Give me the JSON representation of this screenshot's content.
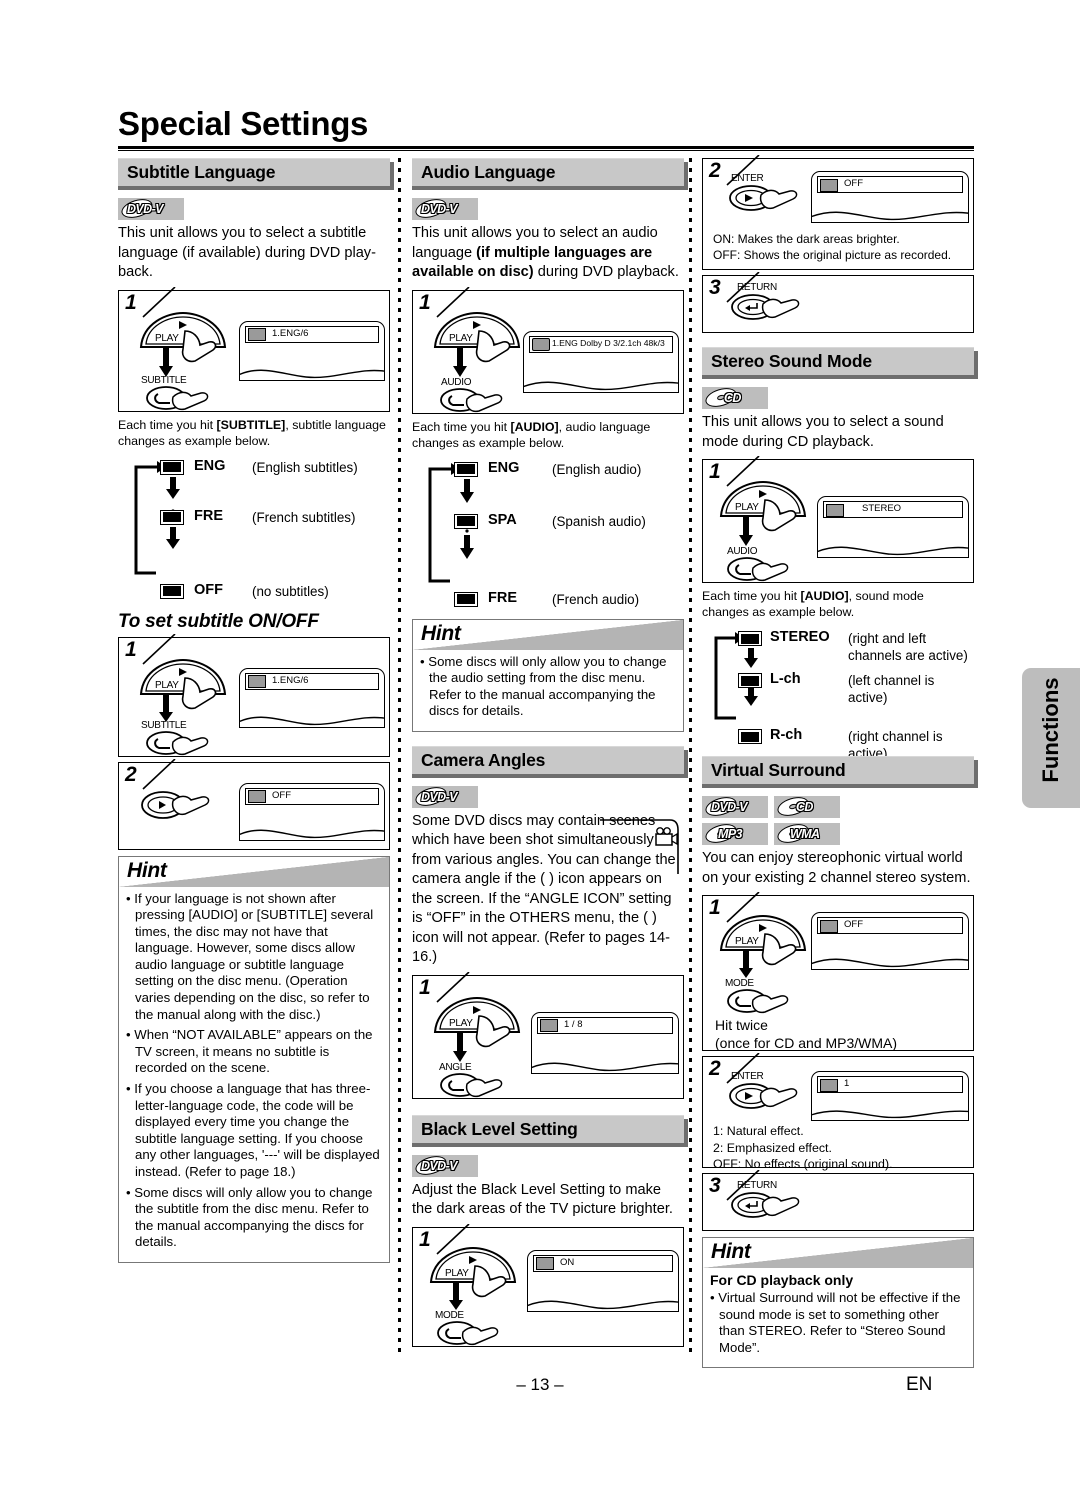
{
  "page": {
    "title": "Special Settings",
    "page_number": "– 13 –",
    "lang_mark": "EN",
    "side_tab": "Functions"
  },
  "col1": {
    "subtitle_language": {
      "heading": "Subtitle Language",
      "badges": [
        "DVD-V"
      ],
      "intro": "This unit allows you to select a subtitle language (if available) during DVD play-back.",
      "step1": {
        "num": "1",
        "btn_top": "PLAY",
        "btn_bottom": "SUBTITLE",
        "osd": "1.ENG/6"
      },
      "caption_a": "Each time you hit ",
      "caption_b": "[SUBTITLE]",
      "caption_c": ", subtitle language changes as example below.",
      "flow": [
        {
          "name": "ENG",
          "desc": "(English subtitles)"
        },
        {
          "name": "FRE",
          "desc": "(French subtitles)"
        },
        {
          "name": "OFF",
          "desc": "(no subtitles)"
        }
      ]
    },
    "to_set_onoff": {
      "subheading": "To set subtitle ON/OFF",
      "step1": {
        "num": "1",
        "btn_top": "PLAY",
        "btn_bottom": "SUBTITLE",
        "osd": "1.ENG/6"
      },
      "step2": {
        "num": "2",
        "osd": "OFF"
      }
    },
    "hint": {
      "title": "Hint",
      "items": [
        "If your language is not shown after pressing [AUDIO] or [SUBTITLE] several times, the disc may not have that language. However, some discs allow audio language or subtitle language setting on the disc menu. (Operation varies depending on the disc, so refer to the manual along with the disc.)",
        "When “NOT AVAILABLE” appears on the TV screen, it means no subtitle is recorded on the scene.",
        "If you choose a language that has three-letter-language code, the code will be displayed every time you change the subtitle language setting. If you choose any other languages, '---' will be displayed instead. (Refer to page 18.)",
        "Some discs will only allow you to change the subtitle from the disc menu. Refer to the manual accompanying the discs for details."
      ]
    }
  },
  "col2": {
    "audio_language": {
      "heading": "Audio Language",
      "badges": [
        "DVD-V"
      ],
      "intro_a": "This unit allows you to select an audio language ",
      "intro_b": "(if multiple languages are available on disc)",
      "intro_c": " during DVD playback.",
      "step1": {
        "num": "1",
        "btn_top": "PLAY",
        "btn_bottom": "AUDIO",
        "osd": "1.ENG  Dolby D  3/2.1ch  48k/3"
      },
      "caption_a": "Each time you hit ",
      "caption_b": "[AUDIO]",
      "caption_c": ", audio language changes as example below.",
      "flow": [
        {
          "name": "ENG",
          "desc": "(English audio)"
        },
        {
          "name": "SPA",
          "desc": "(Spanish audio)"
        },
        {
          "name": "FRE",
          "desc": "(French audio)"
        }
      ]
    },
    "hint": {
      "title": "Hint",
      "items": [
        "Some discs will only allow you to change the audio setting from the disc menu. Refer to the manual accompanying the discs for details."
      ]
    },
    "camera_angles": {
      "heading": "Camera Angles",
      "badges": [
        "DVD-V"
      ],
      "body": "Some DVD discs may contain scenes which have been shot simultaneously from various angles. You can change the camera angle if the (  ) icon appears on the screen. If the “ANGLE ICON” setting is “OFF” in the OTHERS menu, the (  ) icon will not appear. (Refer to pages 14-16.)",
      "step1": {
        "num": "1",
        "btn_top": "PLAY",
        "btn_bottom": "ANGLE",
        "osd": "1 / 8"
      }
    },
    "black_level": {
      "heading": "Black Level Setting",
      "badges": [
        "DVD-V"
      ],
      "body": "Adjust the Black Level Setting to make the dark areas of the TV picture brighter.",
      "step1": {
        "num": "1",
        "btn_top": "PLAY",
        "btn_bottom": "MODE",
        "osd": "ON"
      }
    }
  },
  "col3": {
    "black_level_cont": {
      "step2": {
        "num": "2",
        "btn_top": "ENTER",
        "osd": "OFF",
        "note1": "ON: Makes the dark areas brighter.",
        "note2": "OFF: Shows the original picture as recorded."
      },
      "step3": {
        "num": "3",
        "btn_top": "RETURN"
      }
    },
    "stereo_sound_mode": {
      "heading": "Stereo Sound Mode",
      "badges": [
        "CD"
      ],
      "intro": "This unit allows you to select a sound mode during CD playback.",
      "step1": {
        "num": "1",
        "btn_top": "PLAY",
        "btn_bottom": "AUDIO",
        "osd": "STEREO"
      },
      "caption_a": "Each time you hit ",
      "caption_b": "[AUDIO]",
      "caption_c": ", sound mode changes as example below.",
      "flow": [
        {
          "name": "STEREO",
          "desc": "(right and left channels are active)"
        },
        {
          "name": "L-ch",
          "desc": "(left channel is active)"
        },
        {
          "name": "R-ch",
          "desc": "(right channel is active)"
        }
      ]
    },
    "virtual_surround": {
      "heading": "Virtual Surround",
      "badges": [
        "DVD-V",
        "CD",
        "MP3",
        "WMA"
      ],
      "intro": "You can enjoy stereophonic virtual world on your existing 2 channel stereo system.",
      "step1": {
        "num": "1",
        "btn_top": "PLAY",
        "btn_bottom": "MODE",
        "osd": "OFF",
        "note1": "Hit twice",
        "note2": "(once for CD and MP3/WMA)"
      },
      "step2": {
        "num": "2",
        "btn_top": "ENTER",
        "osd": "1",
        "note1": "1: Natural effect.",
        "note2": "2: Emphasized effect.",
        "note3": "OFF: No effects (original sound)."
      },
      "step3": {
        "num": "3",
        "btn_top": "RETURN"
      },
      "hint": {
        "title": "Hint",
        "subheading": "For CD playback only",
        "items": [
          "Virtual Surround will not be effective if the sound mode is set to something other than STEREO. Refer to “Stereo Sound Mode”."
        ]
      }
    }
  },
  "colors": {
    "gray_bar": "#c8c8c8",
    "gray_shadow": "#6e6e6e",
    "badge_bg": "#bdbdbd"
  }
}
